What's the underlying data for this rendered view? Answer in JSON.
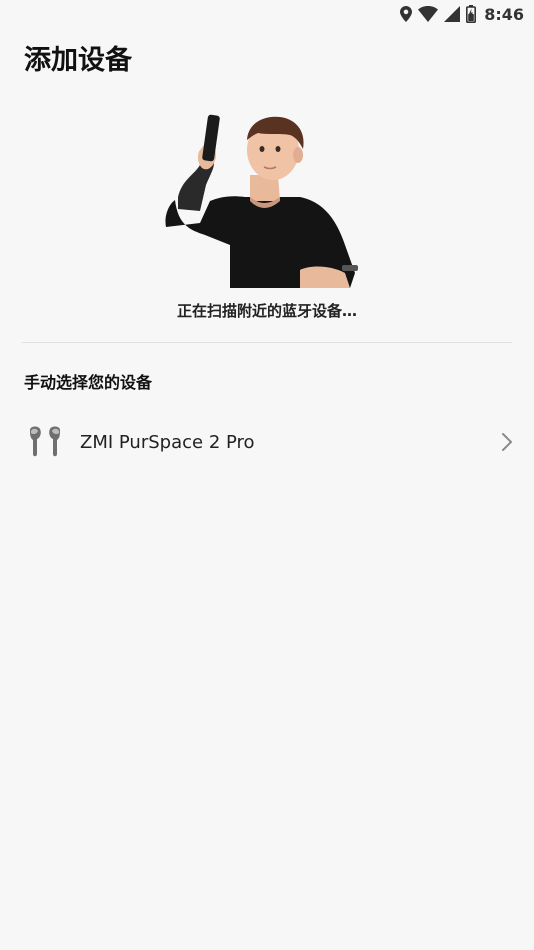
{
  "status_bar": {
    "time": "8:46",
    "icons": [
      "location-icon",
      "wifi-icon",
      "cell-signal-icon",
      "battery-icon"
    ]
  },
  "header": {
    "title": "添加设备"
  },
  "scan": {
    "illustration": "person-holding-phone-illustration",
    "status_text": "正在扫描附近的蓝牙设备…"
  },
  "manual": {
    "section_title": "手动选择您的设备",
    "devices": [
      {
        "name": "ZMI PurSpace 2 Pro",
        "icon": "earbuds-icon"
      }
    ]
  }
}
